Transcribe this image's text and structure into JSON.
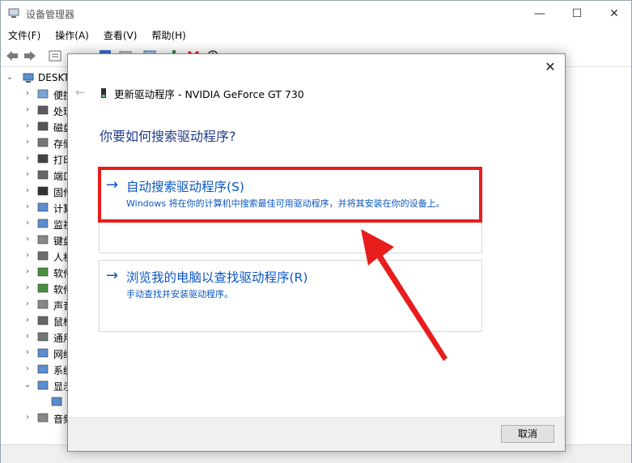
{
  "window": {
    "title": "设备管理器",
    "controls": {
      "minimize": "—",
      "maximize": "☐",
      "close": "✕"
    }
  },
  "menubar": [
    {
      "label": "文件(F)"
    },
    {
      "label": "操作(A)"
    },
    {
      "label": "查看(V)"
    },
    {
      "label": "帮助(H)"
    }
  ],
  "tree": {
    "root": "DESKT",
    "items": [
      {
        "label": "便携",
        "icon": "portable-device-icon"
      },
      {
        "label": "处理",
        "icon": "processor-icon"
      },
      {
        "label": "磁盘",
        "icon": "disk-drive-icon"
      },
      {
        "label": "存储",
        "icon": "storage-controller-icon"
      },
      {
        "label": "打印",
        "icon": "printer-icon"
      },
      {
        "label": "端口",
        "icon": "port-icon"
      },
      {
        "label": "固件",
        "icon": "firmware-icon"
      },
      {
        "label": "计算",
        "icon": "computer-icon"
      },
      {
        "label": "监视",
        "icon": "monitor-icon"
      },
      {
        "label": "键盘",
        "icon": "keyboard-icon"
      },
      {
        "label": "人机",
        "icon": "hid-icon"
      },
      {
        "label": "软件",
        "icon": "software-component-icon"
      },
      {
        "label": "软件",
        "icon": "software-device-icon"
      },
      {
        "label": "声音",
        "icon": "audio-icon"
      },
      {
        "label": "鼠标",
        "icon": "mouse-icon"
      },
      {
        "label": "通用",
        "icon": "usb-icon"
      },
      {
        "label": "网络",
        "icon": "network-adapter-icon"
      },
      {
        "label": "系统",
        "icon": "system-device-icon"
      },
      {
        "label": "显示",
        "icon": "display-adapter-icon"
      },
      {
        "label": "",
        "icon": "display-adapter-icon"
      },
      {
        "label": "音频",
        "icon": "audio-icon"
      }
    ]
  },
  "dialog": {
    "close": "✕",
    "back": "←",
    "header": "更新驱动程序 - NVIDIA GeForce GT 730",
    "question": "你要如何搜索驱动程序?",
    "options": [
      {
        "arrow": "→",
        "title": "自动搜索驱动程序(S)",
        "description": "Windows 将在你的计算机中搜索最佳可用驱动程序，并将其安装在你的设备上。"
      },
      {
        "arrow": "→",
        "title": "浏览我的电脑以查找驱动程序(R)",
        "description": "手动查找并安装驱动程序。"
      }
    ],
    "cancel": "取消"
  },
  "colors": {
    "link_blue": "#0a56c2",
    "question_blue": "#1f3c88",
    "annotation_red": "#e81d1d"
  }
}
